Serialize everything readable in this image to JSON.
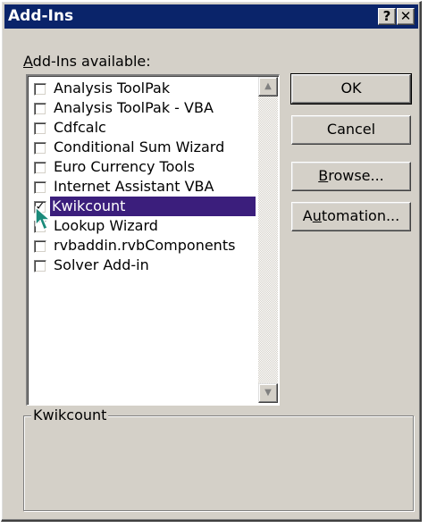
{
  "window": {
    "title": "Add-Ins",
    "help_button": "?",
    "close_button": "✕"
  },
  "list": {
    "label_prefix": "A",
    "label_rest": "dd-Ins available:",
    "items": [
      {
        "label": "Analysis ToolPak",
        "checked": false
      },
      {
        "label": "Analysis ToolPak - VBA",
        "checked": false
      },
      {
        "label": "Cdfcalc",
        "checked": false
      },
      {
        "label": "Conditional Sum Wizard",
        "checked": false
      },
      {
        "label": "Euro Currency Tools",
        "checked": false
      },
      {
        "label": "Internet Assistant VBA",
        "checked": false
      },
      {
        "label": "Kwikcount",
        "checked": true,
        "selected": true
      },
      {
        "label": "Lookup Wizard",
        "checked": false
      },
      {
        "label": "rvbaddin.rvbComponents",
        "checked": false
      },
      {
        "label": "Solver Add-in",
        "checked": false
      }
    ]
  },
  "buttons": {
    "ok": "OK",
    "cancel": "Cancel",
    "browse_mnemonic": "B",
    "browse_rest": "rowse...",
    "automation_pre": "A",
    "automation_mnemonic": "u",
    "automation_rest": "tomation..."
  },
  "description": {
    "group_label": "Kwikcount",
    "text": ""
  },
  "colors": {
    "title_bar": "#0a246a",
    "selection": "#3b1e7c",
    "face": "#d4d0c8"
  }
}
